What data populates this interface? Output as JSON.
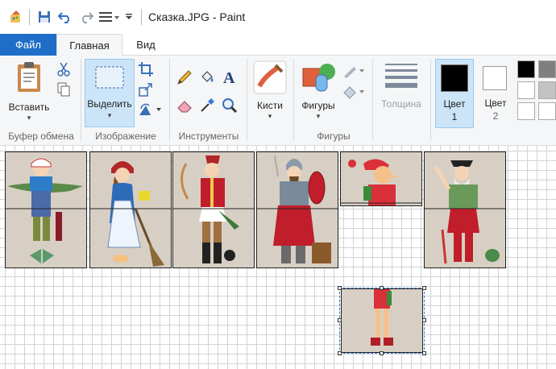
{
  "window": {
    "title": "Сказка.JPG - Paint"
  },
  "tabs": {
    "file": "Файл",
    "home": "Главная",
    "view": "Вид"
  },
  "ribbon": {
    "clipboard": {
      "paste": "Вставить",
      "group": "Буфер обмена"
    },
    "image": {
      "select": "Выделить",
      "group": "Изображение"
    },
    "tools": {
      "group": "Инструменты"
    },
    "brushes": {
      "label": "Кисти"
    },
    "shapes": {
      "label": "Фигуры",
      "group": "Фигуры"
    },
    "size": {
      "label": "Толщина"
    },
    "color1": {
      "label": "Цвет",
      "number": "1",
      "value": "#000000"
    },
    "color2": {
      "label": "Цвет",
      "number": "2",
      "value": "#ffffff"
    },
    "palette": [
      "#000000",
      "#7f7f7f",
      "#ffffff",
      "#c3c3c3",
      "#ffffff",
      "#ffffff"
    ]
  },
  "canvas": {
    "characters": [
      "fisherman",
      "girl",
      "archer",
      "soldier",
      "pinocchio",
      "old-man",
      "legs-fragment"
    ]
  }
}
